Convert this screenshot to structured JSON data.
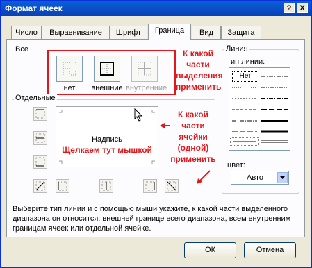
{
  "window": {
    "title": "Формат ячеек",
    "help_label": "?",
    "close_label": "X"
  },
  "tabs": [
    {
      "label": "Число"
    },
    {
      "label": "Выравнивание"
    },
    {
      "label": "Шрифт"
    },
    {
      "label": "Граница",
      "active": true
    },
    {
      "label": "Вид"
    },
    {
      "label": "Защита"
    }
  ],
  "presets": {
    "group_label": "Все",
    "items": [
      {
        "label": "нет",
        "icon": "border-none-icon"
      },
      {
        "label": "внешние",
        "icon": "border-outline-icon"
      },
      {
        "label": "внутренние",
        "icon": "border-inside-icon",
        "disabled": true
      }
    ]
  },
  "individual": {
    "group_label": "Отдельные"
  },
  "preview": {
    "label": "Надпись"
  },
  "line": {
    "group_label": "Линия",
    "style_label": "тип линии:",
    "none_label": "Нет",
    "color_label": "цвет:",
    "color_value": "Авто"
  },
  "annotations": {
    "top": "К какой части выделения применить",
    "middle": "К какой части ячейки (одной) применить",
    "click": "Щелкаем тут мышкой",
    "color": "#e0181b"
  },
  "hint": "Выберите тип линии и с помощью мыши укажите, к какой части выделенного диапазона он относится: внешней границе всего диапазона, всем внутренним границам ячеек или отдельной ячейке.",
  "buttons": {
    "ok": "ОК",
    "cancel": "Отмена"
  }
}
